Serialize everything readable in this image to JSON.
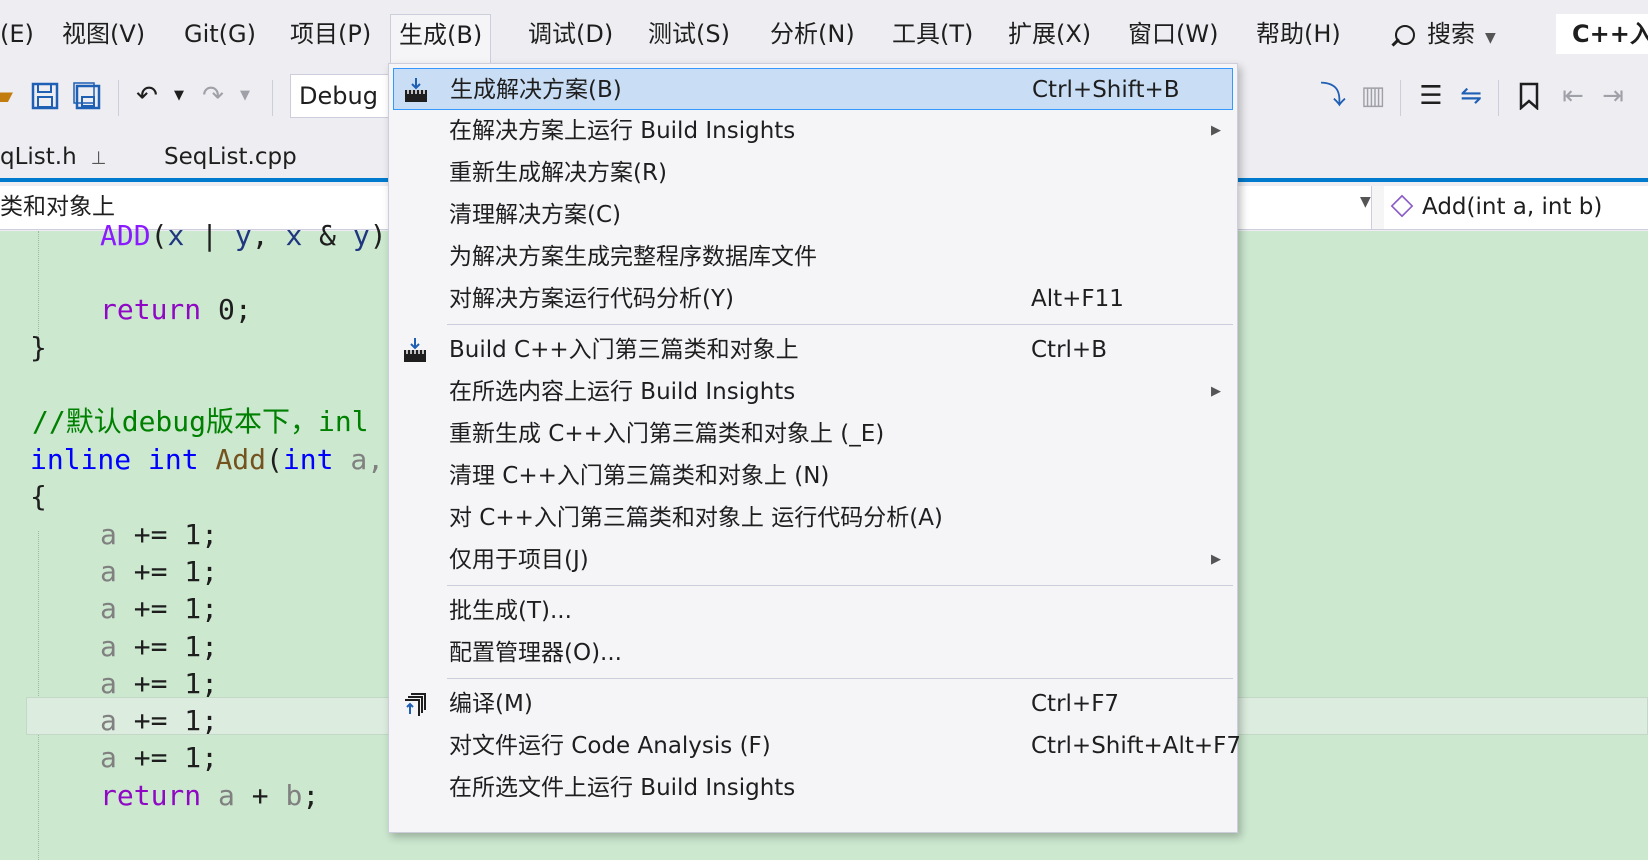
{
  "menubar": {
    "items": [
      "(E)",
      "视图(V)",
      "Git(G)",
      "项目(P)",
      "生成(B)",
      "调试(D)",
      "测试(S)",
      "分析(N)",
      "工具(T)",
      "扩展(X)",
      "窗口(W)",
      "帮助(H)"
    ],
    "search_label": "搜索",
    "solution_title": "C++入"
  },
  "toolbar": {
    "config": "Debug"
  },
  "tabs": {
    "tab1": "qList.h",
    "tab2": "SeqList.cpp"
  },
  "navbar": {
    "left": "类和对象上",
    "right": "Add(int a, int b)"
  },
  "code": {
    "line1": [
      "ADD",
      "(",
      "x",
      " | ",
      "y",
      ", ",
      "x",
      " & ",
      "y",
      ")"
    ],
    "line2": [
      "return",
      " 0;"
    ],
    "line3": "}",
    "line4": "//默认debug版本下，inl",
    "line5": [
      "inline",
      " ",
      "int",
      " ",
      "Add",
      "(",
      "int",
      " a,"
    ],
    "line6": "{",
    "stmt": [
      "a",
      " += 1;"
    ],
    "line_ret": [
      "return",
      " a",
      " + ",
      "b",
      ";"
    ]
  },
  "build_menu": {
    "items": [
      {
        "label": "生成解决方案(B)",
        "shortcut": "Ctrl+Shift+B",
        "icon": "build-solution-icon",
        "highlight": true
      },
      {
        "label": "在解决方案上运行 Build Insights",
        "submenu": true
      },
      {
        "label": "重新生成解决方案(R)"
      },
      {
        "label": "清理解决方案(C)"
      },
      {
        "label": "为解决方案生成完整程序数据库文件"
      },
      {
        "label": "对解决方案运行代码分析(Y)",
        "shortcut": "Alt+F11"
      },
      {
        "label": "Build C++入门第三篇类和对象上",
        "shortcut": "Ctrl+B",
        "icon": "build-project-icon"
      },
      {
        "label": "在所选内容上运行 Build Insights",
        "submenu": true
      },
      {
        "label": "重新生成 C++入门第三篇类和对象上 (_E)"
      },
      {
        "label": "清理 C++入门第三篇类和对象上 (N)"
      },
      {
        "label": "对 C++入门第三篇类和对象上 运行代码分析(A)"
      },
      {
        "label": "仅用于项目(J)",
        "submenu": true
      },
      {
        "label": "批生成(T)..."
      },
      {
        "label": "配置管理器(O)..."
      },
      {
        "label": "编译(M)",
        "shortcut": "Ctrl+F7",
        "icon": "compile-icon"
      },
      {
        "label": "对文件运行 Code Analysis (F)",
        "shortcut": "Ctrl+Shift+Alt+F7"
      },
      {
        "label": "在所选文件上运行 Build Insights"
      }
    ]
  },
  "colors": {
    "accent": "#007acc",
    "editor_bg": "#cce8cf",
    "menu_highlight": "#c9def5",
    "keyword": "#0000ff",
    "control_keyword": "#8f08c4"
  }
}
